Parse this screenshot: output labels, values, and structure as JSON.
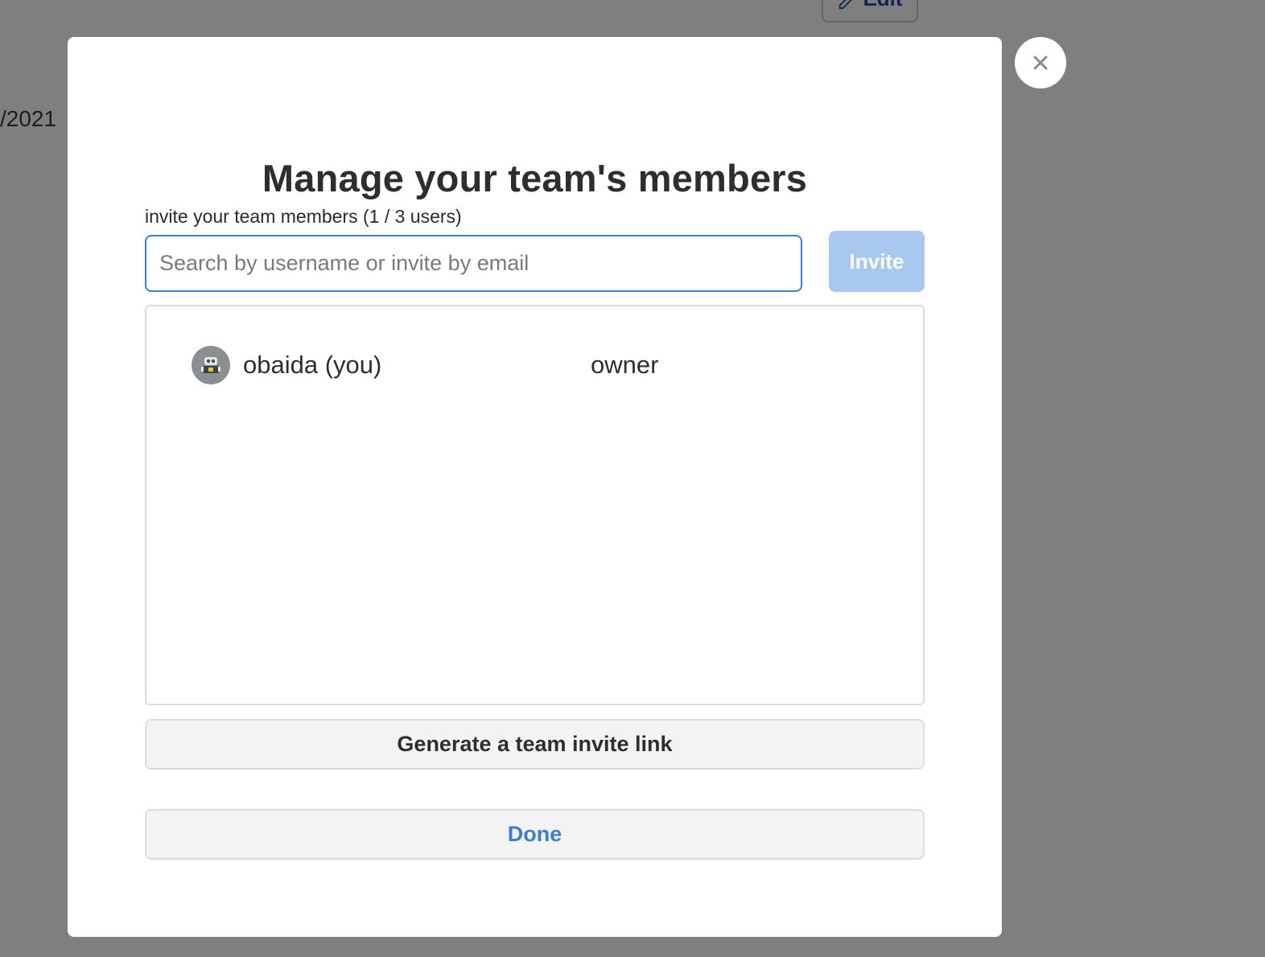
{
  "background": {
    "edit_button_label": "Edit",
    "date_fragment": "/2021"
  },
  "modal": {
    "title": "Manage your team's members",
    "invite_label": "invite your team members (1 / 3 users)",
    "search": {
      "value": "",
      "placeholder": "Search by username or invite by email"
    },
    "invite_button_label": "Invite",
    "members": [
      {
        "name": "obaida (you)",
        "role": "owner",
        "avatar_icon": "robot-avatar-icon"
      }
    ],
    "generate_link_label": "Generate a team invite link",
    "done_label": "Done",
    "close_icon": "close-icon"
  },
  "colors": {
    "accent": "#3d7ecf",
    "invite_button_disabled": "#a9c8ef",
    "overlay": "rgba(0,0,0,0.5)"
  }
}
